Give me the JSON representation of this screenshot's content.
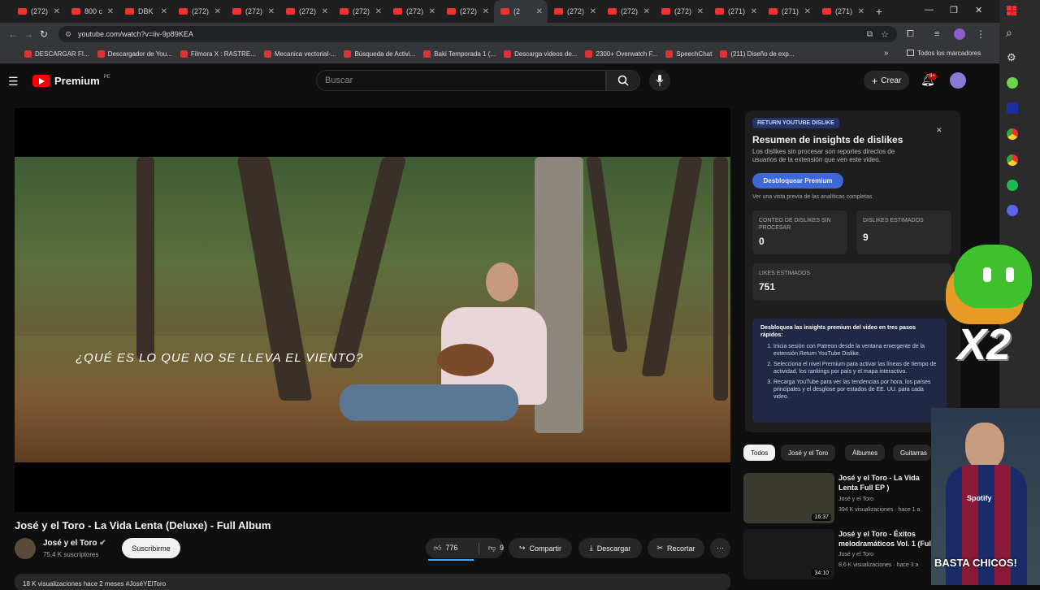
{
  "browser": {
    "tabs": [
      "(272)",
      "800 c",
      "DBK",
      "(272)",
      "(272)",
      "(272)",
      "(272)",
      "(272)",
      "(272)",
      "(2",
      "(272)",
      "(272)",
      "(272)",
      "(271)",
      "(271)",
      "(271)"
    ],
    "url": "youtube.com/watch?v=iiv-9p89KEA",
    "bookmarks": [
      "DESCARGAR FI...",
      "Descargador de You...",
      "Filmora X : RASTRE...",
      "Mecanica vectorial-...",
      "Búsqueda de Activi...",
      "Baki Temporada 1 (...",
      "Descarga videos de...",
      "2300+ Overwatch F...",
      "SpeechChat",
      "(211) Diseño de exp..."
    ],
    "all_bookmarks": "Todos los marcadores"
  },
  "header": {
    "logo": "Premium",
    "logo_suffix": "PE",
    "search_placeholder": "Buscar",
    "create": "Crear",
    "notifications": "9+"
  },
  "video": {
    "caption": "¿QUÉ ES LO QUE NO SE LLEVA EL VIENTO?",
    "title": "José y el Toro - La Vida Lenta (Deluxe) - Full Album",
    "channel": "José y el Toro",
    "subscribers": "75,4 K suscriptores",
    "subscribe": "Suscribirme",
    "likes": "776",
    "dislikes": "9",
    "share": "Compartir",
    "download": "Descargar",
    "clip": "Recortar",
    "description": "18 K visualizaciones  hace 2 meses  #JoséYElToro"
  },
  "panel": {
    "badge": "RETURN YOUTUBE DISLIKE",
    "title": "Resumen de insights de dislikes",
    "subtitle": "Los dislikes sin procesar son reportes directos de usuarios de la extensión que ven este video.",
    "unlock": "Desbloquear Premium",
    "preview": "Ver una vista previa de las analíticas completas",
    "raw_label": "CONTEO DE DISLIKES SIN PROCESAR",
    "raw_value": "0",
    "est_label": "DISLIKES ESTIMADOS",
    "est_value": "9",
    "likes_label": "LIKES ESTIMADOS",
    "likes_value": "751",
    "steps_title": "Desbloquea las insights premium del video en tres pasos rápidos:",
    "step1": "Inicia sesión con Patreon desde la ventana emergente de la extensión Return YouTube Dislike.",
    "step2": "Selecciona el nivel Premium para activar las líneas de tiempo de actividad, los rankings por país y el mapa interactivo.",
    "step3": "Recarga YouTube para ver las tendencias por hora, los países principales y el desglose por estados de EE. UU. para cada video."
  },
  "chips": [
    "Todos",
    "José y el Toro",
    "Álbumes",
    "Guitarras"
  ],
  "recs": [
    {
      "title": "José y el Toro - La Vida Lenta Full EP )",
      "channel": "José y el Toro",
      "meta": "394 K visualizaciones · hace 1 a",
      "duration": "16:37"
    },
    {
      "title": "José y el Toro - Éxitos melodramáticos Vol. 1 (Full",
      "channel": "José y el Toro",
      "meta": "8,6 K visualizaciones · hace 3 a",
      "duration": "34:10"
    }
  ],
  "overlay": {
    "multiplier": "X2",
    "webcam_caption": "BASTA CHICOS!",
    "shirt": "Spotify"
  }
}
